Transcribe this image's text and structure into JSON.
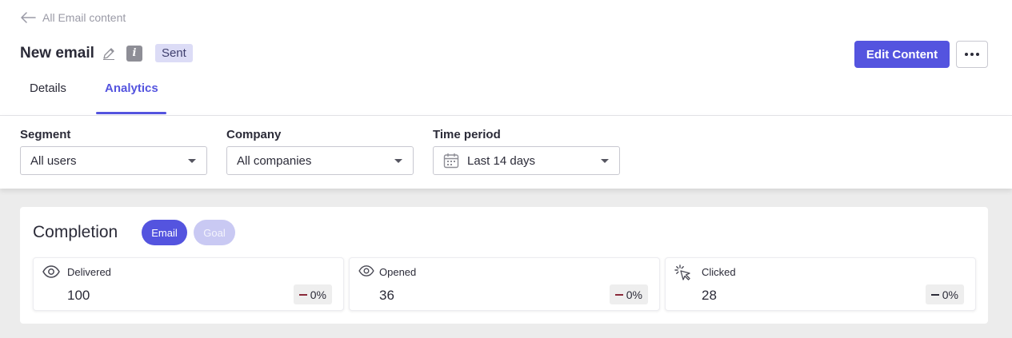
{
  "breadcrumb": {
    "label": "All Email content"
  },
  "header": {
    "title": "New email",
    "status": "Sent"
  },
  "actions": {
    "edit_label": "Edit Content"
  },
  "tabs": [
    {
      "label": "Details",
      "active": false
    },
    {
      "label": "Analytics",
      "active": true
    }
  ],
  "filters": {
    "segment": {
      "label": "Segment",
      "value": "All users"
    },
    "company": {
      "label": "Company",
      "value": "All companies"
    },
    "time_period": {
      "label": "Time period",
      "value": "Last 14 days"
    }
  },
  "completion": {
    "title": "Completion",
    "toggles": [
      {
        "label": "Email",
        "active": true
      },
      {
        "label": "Goal",
        "active": false
      }
    ],
    "stats": [
      {
        "label": "Delivered",
        "value": "100",
        "change": "0%",
        "icon": "eye-icon",
        "change_color": "#8a2a3a"
      },
      {
        "label": "Opened",
        "value": "36",
        "change": "0%",
        "icon": "eye-icon",
        "change_color": "#8a2a3a"
      },
      {
        "label": "Clicked",
        "value": "28",
        "change": "0%",
        "icon": "click-cursor-icon",
        "change_color": "#2b2b38"
      }
    ]
  },
  "colors": {
    "accent": "#5454df",
    "badge_bg": "#dcdcf6"
  }
}
